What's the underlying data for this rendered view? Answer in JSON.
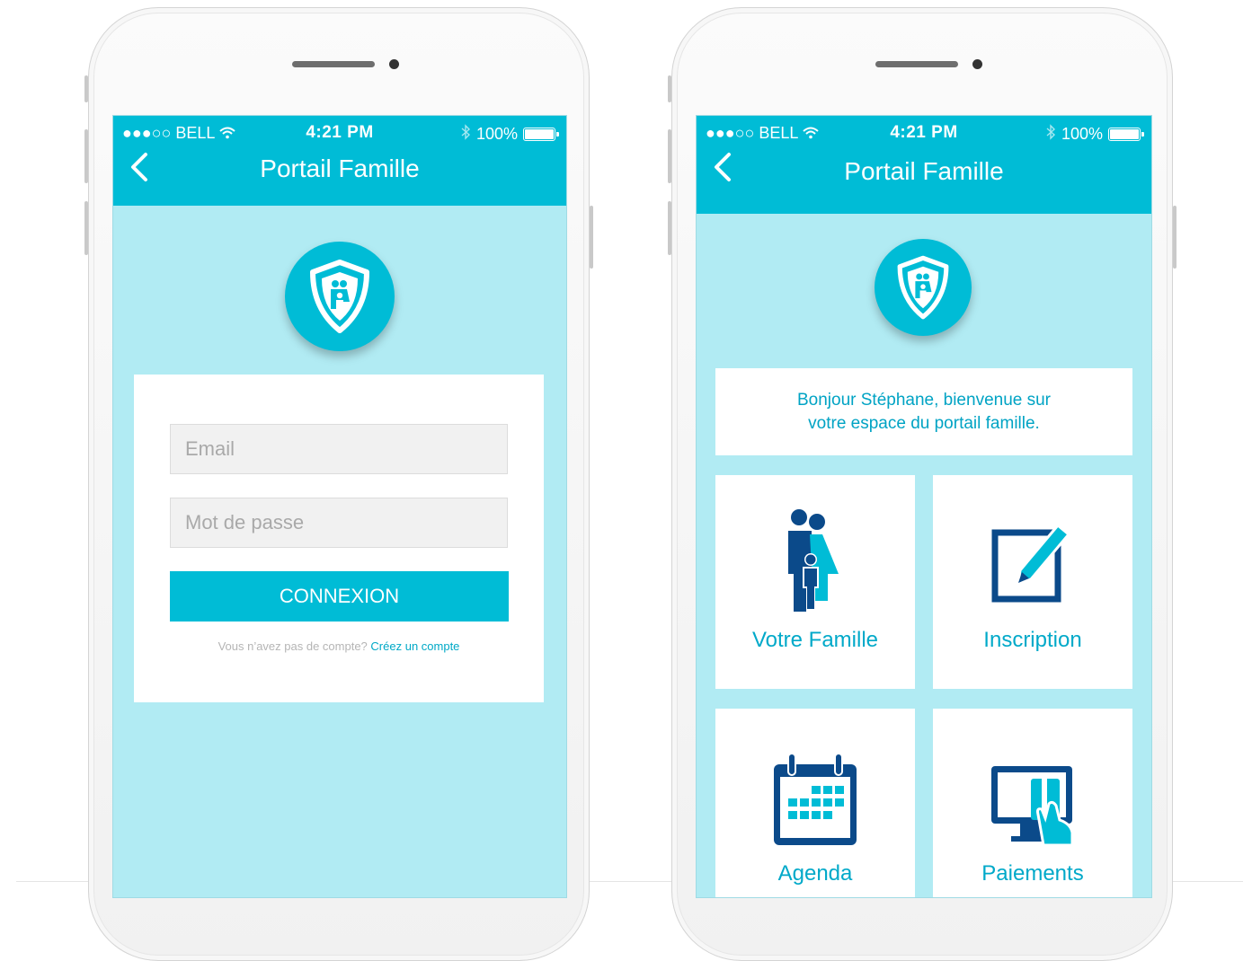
{
  "status_bar": {
    "carrier": "●●●○○ BELL",
    "time": "4:21 PM",
    "battery": "100%"
  },
  "nav": {
    "title": "Portail Famille",
    "back_glyph": "‹"
  },
  "login": {
    "email_placeholder": "Email",
    "password_placeholder": "Mot de passe",
    "button_label": "CONNEXION",
    "no_account_text": "Vous n’avez pas de compte?",
    "create_account_link": "Créez un compte"
  },
  "dashboard": {
    "welcome_line1": "Bonjour Stéphane, bienvenue sur",
    "welcome_line2": "votre espace du portail famille.",
    "tiles": [
      {
        "label": "Votre Famille",
        "icon": "family-icon"
      },
      {
        "label": "Inscription",
        "icon": "edit-pencil-icon"
      },
      {
        "label": "Agenda",
        "icon": "calendar-icon"
      },
      {
        "label": "Paiements",
        "icon": "payment-card-icon"
      }
    ]
  },
  "colors": {
    "primary": "#00bcd6",
    "screen_bg": "#b1ebf3",
    "icon_dark": "#0b4a8a",
    "icon_accent": "#00bcd6"
  }
}
